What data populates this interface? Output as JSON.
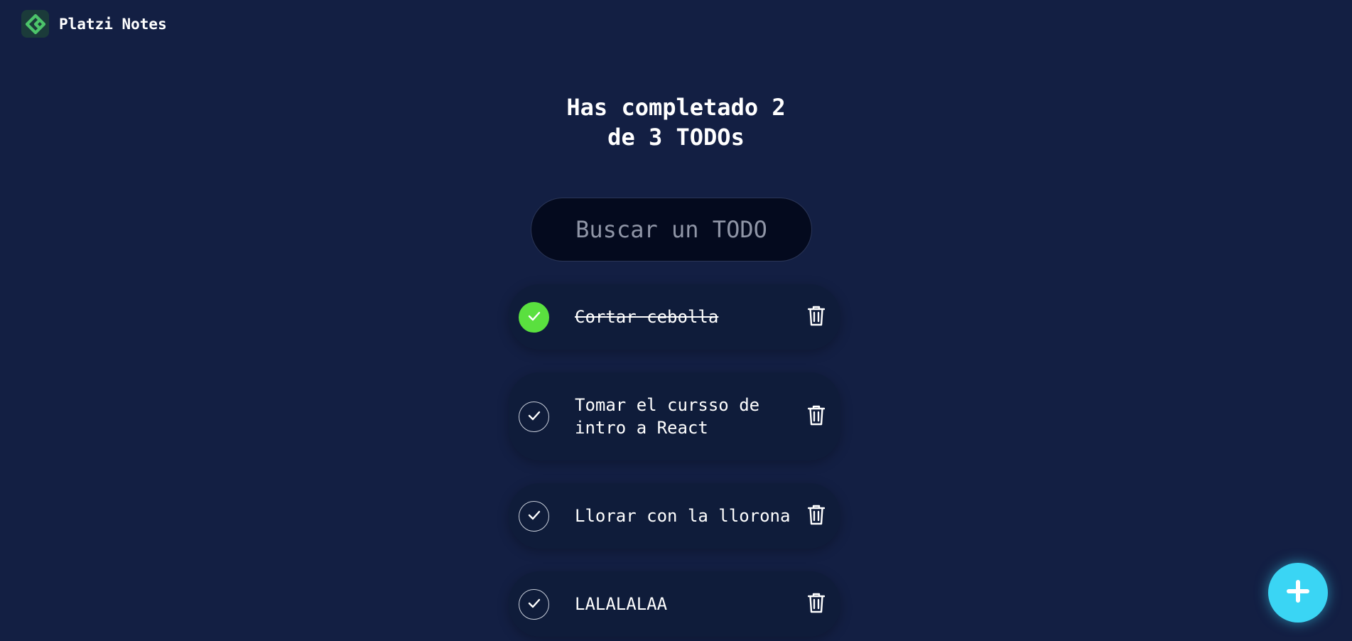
{
  "brand": {
    "name": "Platzi Notes",
    "logo_icon": "platzi-logo-icon",
    "logo_color": "#4cc46a"
  },
  "header": {
    "title_line1": "Has completado 2",
    "title_line2": "de 3 TODOs"
  },
  "search": {
    "placeholder": "Buscar un TODO",
    "value": ""
  },
  "todos": [
    {
      "text": "Cortar cebolla",
      "completed": true
    },
    {
      "text": "Tomar el cursso de intro a React",
      "completed": false
    },
    {
      "text": "Llorar con la llorona",
      "completed": false
    },
    {
      "text": "LALALALAA",
      "completed": false
    }
  ],
  "icons": {
    "check": "check-icon",
    "delete": "trash-icon",
    "add": "plus-icon"
  },
  "colors": {
    "background": "#131f43",
    "item_background": "#0f1c3a",
    "completed_check": "#5ae03f",
    "fab": "#3ad5f4"
  }
}
